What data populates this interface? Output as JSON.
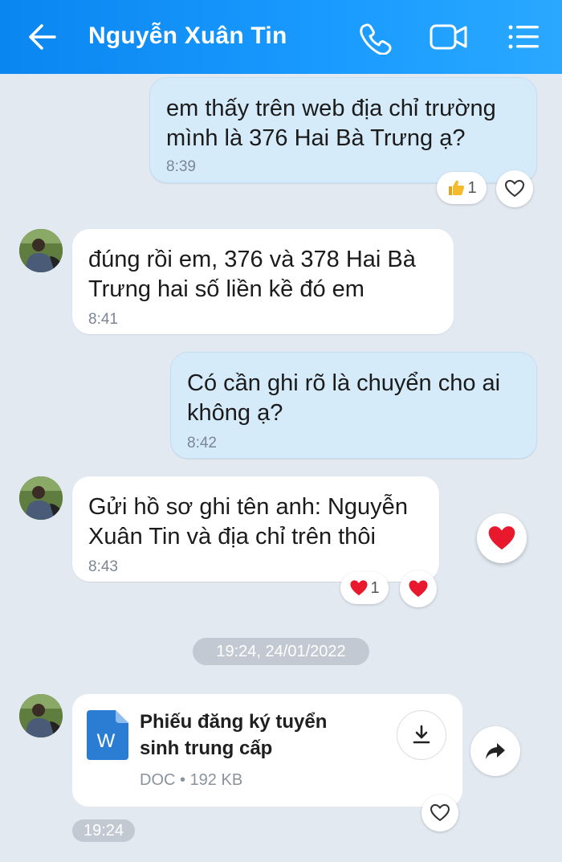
{
  "header": {
    "title": "Nguyễn Xuân Tin",
    "icons": [
      "back-arrow-icon",
      "phone-icon",
      "video-camera-icon",
      "list-menu-icon"
    ]
  },
  "messages": [
    {
      "direction": "outgoing",
      "lines": [
        "em thấy trên web địa chỉ trường",
        "mình là 376 Hai Bà Trưng ạ?"
      ],
      "time": "8:39",
      "reaction": {
        "icon": "thumbs-up",
        "count": "1"
      }
    },
    {
      "direction": "incoming",
      "lines": [
        "đúng rồi em, 376 và 378 Hai Bà",
        "Trưng hai số liền kề đó em"
      ],
      "time": "8:41"
    },
    {
      "direction": "outgoing",
      "lines": [
        "Có cần ghi rõ là chuyển cho ai",
        "không ạ?"
      ],
      "time": "8:42"
    },
    {
      "direction": "incoming",
      "lines": [
        "Gửi hồ sơ ghi tên anh: Nguyễn",
        "Xuân Tin và địa chỉ trên thôi"
      ],
      "time": "8:43",
      "reaction": {
        "icon": "heart",
        "count": "1"
      }
    }
  ],
  "date_separator": "19:24, 24/01/2022",
  "file": {
    "name_lines": [
      "Phiếu đăng ký tuyển",
      "sinh trung cấp"
    ],
    "icon_letter": "W",
    "type": "DOC",
    "size": "192 KB",
    "meta": "DOC • 192 KB",
    "time": "19:24"
  },
  "colors": {
    "header": "#1a9bff",
    "background": "#e2e9f1",
    "outgoing_bubble": "#d5ebfa",
    "incoming_bubble": "#ffffff",
    "heart": "#e8192c",
    "doc_icon": "#2b7cd3"
  }
}
